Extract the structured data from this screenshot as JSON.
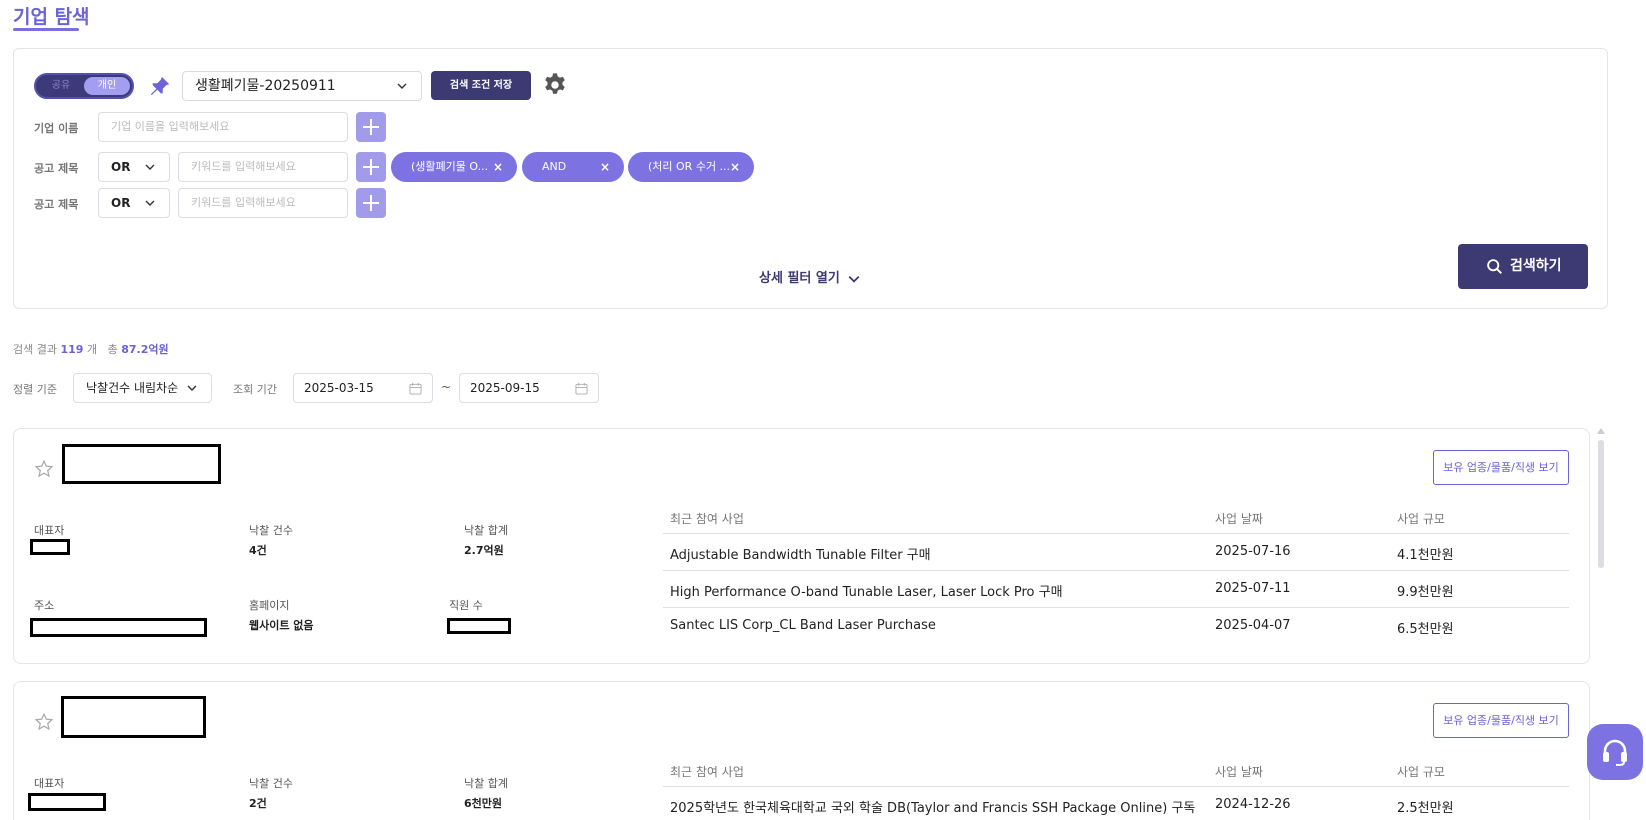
{
  "page": {
    "title": "기업 탐색"
  },
  "search": {
    "toggle": {
      "off": "공유",
      "on": "개인"
    },
    "preset": "생활폐기물-20250911",
    "save_label": "검색 조건 저장",
    "company_label": "기업 이름",
    "company_placeholder": "기업 이름을 입력해보세요",
    "rows": [
      {
        "label": "공고 제목",
        "op": "OR",
        "placeholder": "키워드를 입력해보세요"
      },
      {
        "label": "공고 제목",
        "op": "OR",
        "placeholder": "키워드를 입력해보세요"
      }
    ],
    "chips": [
      "(생활폐기물 O...",
      "AND",
      "(처리 OR 수거 ..."
    ],
    "detail_filter": "상세 필터 열기",
    "search_btn": "검색하기"
  },
  "results": {
    "prefix": "검색 결과",
    "count": "119",
    "count_unit": "개",
    "total_label": "총",
    "total": "87.2억원"
  },
  "sort": {
    "label": "정렬 기준",
    "value": "낙찰건수 내림차순",
    "period_label": "조회 기간",
    "start": "2025-03-15",
    "tilde": "~",
    "end": "2025-09-15"
  },
  "cards": [
    {
      "holdings_btn": "보유 업종/물품/직생 보기",
      "rep_label": "대표자",
      "win_count_label": "낙찰 건수",
      "win_count": "4건",
      "win_total_label": "낙찰 합계",
      "win_total": "2.7억원",
      "address_label": "주소",
      "homepage_label": "홈페이지",
      "homepage": "웹사이트 없음",
      "employees_label": "직원 수",
      "recent_head": {
        "project": "최근 참여 사업",
        "date": "사업 날짜",
        "size": "사업 규모"
      },
      "recent": [
        {
          "project": "Adjustable Bandwidth Tunable Filter 구매",
          "date": "2025-07-16",
          "size": "4.1천만원"
        },
        {
          "project": "High Performance O-band Tunable Laser, Laser Lock Pro 구매",
          "date": "2025-07-11",
          "size": "9.9천만원"
        },
        {
          "project": "Santec LIS Corp_CL Band Laser Purchase",
          "date": "2025-04-07",
          "size": "6.5천만원"
        }
      ]
    },
    {
      "holdings_btn": "보유 업종/물품/직생 보기",
      "rep_label": "대표자",
      "win_count_label": "낙찰 건수",
      "win_count": "2건",
      "win_total_label": "낙찰 합계",
      "win_total": "6천만원",
      "recent_head": {
        "project": "최근 참여 사업",
        "date": "사업 날짜",
        "size": "사업 규모"
      },
      "recent": [
        {
          "project": "2025학년도 한국체육대학교 국외 학술 DB(Taylor and Francis SSH Package Online) 구독",
          "date": "2024-12-26",
          "size": "2.5천만원"
        }
      ]
    }
  ],
  "colors": {
    "accent": "#6b63d6",
    "dark": "#3c3973",
    "chip": "#7c72e2"
  }
}
